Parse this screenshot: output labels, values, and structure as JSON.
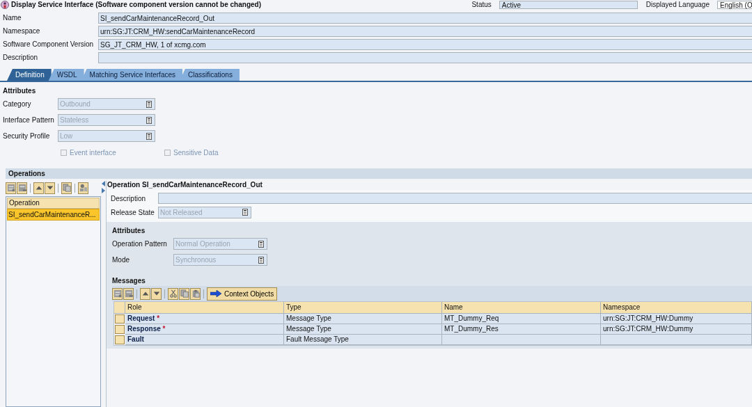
{
  "window": {
    "title": "Display Service Interface (Software component version cannot be changed)"
  },
  "header_fields": [
    {
      "label": "Status",
      "value": "Active",
      "kind": "display"
    },
    {
      "label": "Displayed Language",
      "value": "English (O",
      "kind": "select"
    }
  ],
  "fields": [
    {
      "label": "Name",
      "value": "SI_sendCarMaintenanceRecord_Out"
    },
    {
      "label": "Namespace",
      "value": "urn:SG:JT:CRM_HW:sendCarMaintenanceRecord"
    },
    {
      "label": "Software Component Version",
      "value": "SG_JT_CRM_HW, 1 of xcmg.com"
    },
    {
      "label": "Description"
    }
  ],
  "tabs": [
    {
      "label": "Definition",
      "selected": true
    },
    {
      "label": "WSDL",
      "selected": false
    },
    {
      "label": "Matching Service Interfaces",
      "selected": false
    },
    {
      "label": "Classifications",
      "selected": false
    }
  ],
  "attributes": {
    "title": "Attributes",
    "dropdowns": [
      {
        "label": "Category",
        "value": "Outbound",
        "disabled": true
      },
      {
        "label": "Interface Pattern",
        "value": "Stateless",
        "disabled": true
      },
      {
        "label": "Security Profile",
        "value": "Low",
        "disabled": true
      }
    ],
    "checkboxes": [
      {
        "label": "Event interface",
        "checked": false,
        "disabled": true
      },
      {
        "label": "Sensitive Data",
        "checked": false,
        "disabled": true
      }
    ]
  },
  "operations": {
    "title": "Operations",
    "list": {
      "column": "Operation",
      "items": [
        {
          "label": "SI_sendCarMaintenanceR...",
          "selected": true
        }
      ]
    },
    "detail": {
      "title": "Operation SI_sendCarMaintenanceRecord_Out",
      "description": {
        "label": "Description"
      },
      "release_state": {
        "label": "Release State",
        "value": "Not Released",
        "disabled": true
      },
      "attributes": {
        "title": "Attributes",
        "dropdowns": [
          {
            "label": "Operation Pattern",
            "value": "Normal Operation",
            "disabled": true
          },
          {
            "label": "Mode",
            "value": "Synchronous",
            "disabled": true
          }
        ]
      },
      "messages": {
        "title": "Messages",
        "context_button": "Context Objects",
        "columns": [
          "Role",
          "Type",
          "Name",
          "Namespace"
        ],
        "rows": [
          {
            "role": "Request",
            "required_mark": "*",
            "type": "Message Type",
            "name": "MT_Dummy_Req",
            "namespace": "urn:SG:JT:CRM_HW:Dummy"
          },
          {
            "role": "Response",
            "required_mark": "*",
            "type": "Message Type",
            "name": "MT_Dummy_Res",
            "namespace": "urn:SG:JT:CRM_HW:Dummy"
          },
          {
            "role": "Fault",
            "type": "Fault Message Type"
          }
        ]
      }
    }
  }
}
